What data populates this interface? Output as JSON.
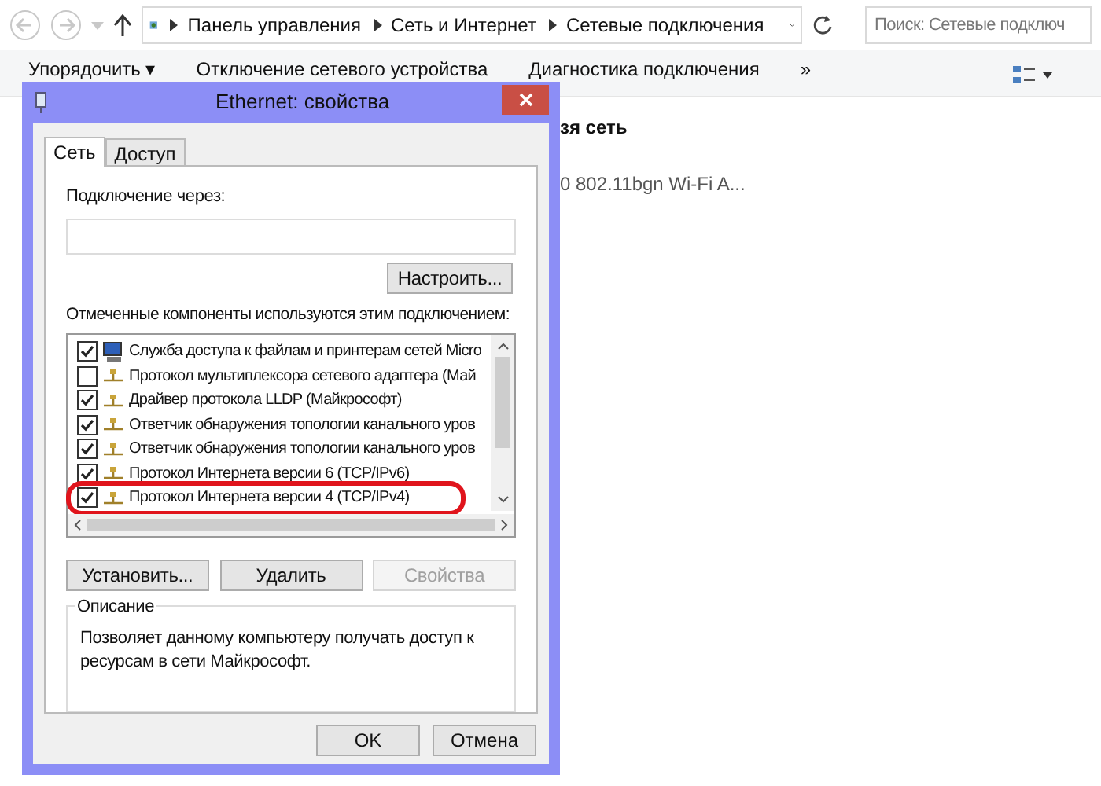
{
  "explorer": {
    "breadcrumbs": [
      "Панель управления",
      "Сеть и Интернет",
      "Сетевые подключения"
    ],
    "search": {
      "placeholder": "Поиск: Сетевые подключ"
    },
    "toolbar": [
      "Упорядочить ▾",
      "Отключение сетевого устройства",
      "Диагностика подключения",
      "»"
    ],
    "connection_fragments": [
      "зя сеть",
      "0 802.11bgn Wi-Fi A..."
    ]
  },
  "dialog": {
    "title": "Ethernet: свойства",
    "tabs": [
      {
        "label": "Сеть",
        "selected": true
      },
      {
        "label": "Доступ",
        "selected": false
      }
    ],
    "connect_using_label": "Подключение через:",
    "configure_button": "Настроить...",
    "components_label": "Отмеченные компоненты используются этим подключением:",
    "components": [
      {
        "label": "Служба доступа к файлам и принтерам сетей Micro",
        "kind": "service",
        "checked": true,
        "highlighted": false
      },
      {
        "label": "Протокол мультиплексора сетевого адаптера (Май",
        "kind": "protocol",
        "checked": false,
        "highlighted": false
      },
      {
        "label": "Драйвер протокола LLDP (Майкрософт)",
        "kind": "protocol",
        "checked": true,
        "highlighted": false
      },
      {
        "label": "Ответчик обнаружения топологии канального уров",
        "kind": "protocol",
        "checked": true,
        "highlighted": false
      },
      {
        "label": "Ответчик обнаружения топологии канального уров",
        "kind": "protocol",
        "checked": true,
        "highlighted": false
      },
      {
        "label": "Протокол Интернета версии 6 (TCP/IPv6)",
        "kind": "protocol",
        "checked": true,
        "highlighted": false
      },
      {
        "label": "Протокол Интернета версии 4 (TCP/IPv4)",
        "kind": "protocol",
        "checked": true,
        "highlighted": true
      }
    ],
    "action_buttons": [
      {
        "label": "Установить...",
        "disabled": false
      },
      {
        "label": "Удалить",
        "disabled": false
      },
      {
        "label": "Свойства",
        "disabled": true
      }
    ],
    "description": {
      "title": "Описание",
      "text": "Позволяет данному компьютеру получать доступ к ресурсам в сети Майкрософт."
    },
    "footer_buttons": [
      "OK",
      "Отмена"
    ]
  }
}
